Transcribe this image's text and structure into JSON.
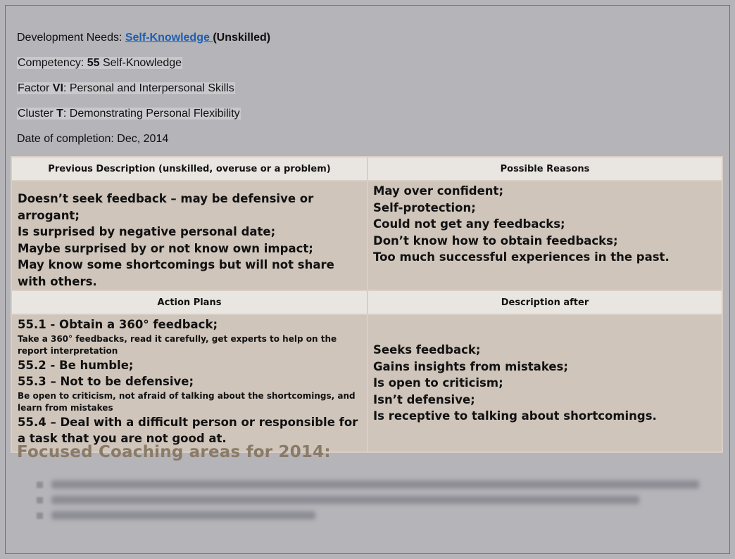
{
  "header": {
    "dev_needs_label": "Development Needs: ",
    "dev_needs_link": "Self-Knowledge ",
    "dev_needs_suffix": "(Unskilled)",
    "competency_label": "Competency: ",
    "competency_number": "55",
    "competency_name": " Self-Knowledge",
    "factor_label": "Factor ",
    "factor_roman": "VI",
    "factor_name": ": Personal and Interpersonal Skills",
    "cluster_label": "Cluster ",
    "cluster_letter": "T",
    "cluster_name": ": Demonstrating Personal Flexibility",
    "date_label": "Date of completion: Dec, 2014"
  },
  "table": {
    "col1_header": "Previous Description (unskilled, overuse or a problem)",
    "col2_header": "Possible Reasons",
    "col3_header": "Action Plans",
    "col4_header": "Description after",
    "previous": [
      "Doesn’t seek feedback – may be defensive or arrogant;",
      "Is surprised by negative personal date;",
      "Maybe surprised by or not know own impact;",
      "May know some shortcomings but will not share with others."
    ],
    "reasons": [
      "May over confident;",
      "Self-protection;",
      "Could not get any feedbacks;",
      "Don’t know how to obtain feedbacks;",
      "Too much successful experiences in the past."
    ],
    "plans": {
      "p1": "55.1 - Obtain a 360° feedback;",
      "p1_note": "Take a 360° feedbacks, read it carefully, get experts to help on the report interpretation",
      "p2": "55.2 - Be humble;",
      "p3": "55.3 – Not to be defensive;",
      "p3_note": "Be open to criticism, not afraid of talking about the shortcomings, and learn from mistakes",
      "p4": "55.4 – Deal with a difficult person or responsible for a task that you are not good at."
    },
    "after": [
      "Seeks feedback;",
      "Gains insights from mistakes;",
      "Is open to criticism;",
      "Isn’t defensive;",
      "Is receptive to talking about shortcomings."
    ]
  },
  "coaching": {
    "title": "Focused Coaching areas for 2014:"
  }
}
